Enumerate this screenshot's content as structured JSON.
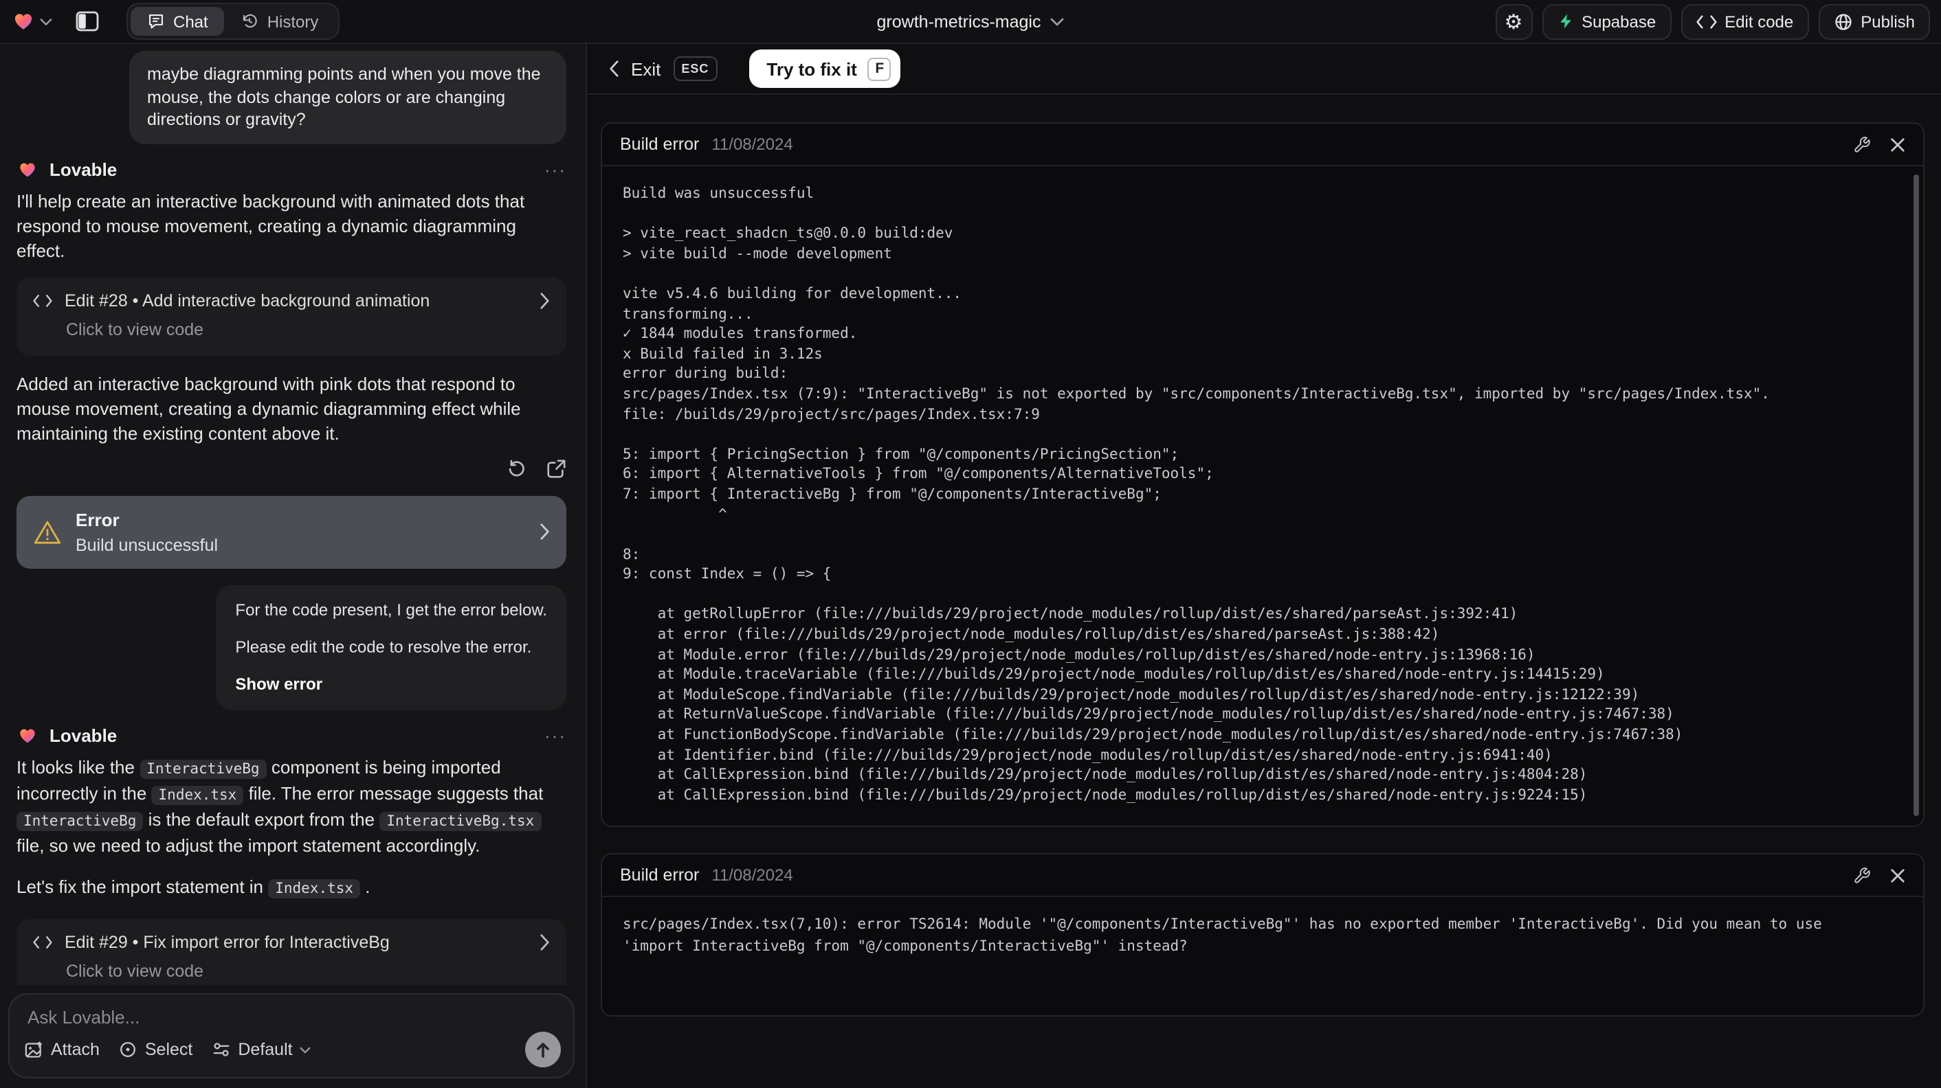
{
  "topbar": {
    "tabs": {
      "chat": "Chat",
      "history": "History"
    },
    "project_name": "growth-metrics-magic",
    "actions": {
      "supabase": "Supabase",
      "edit_code": "Edit code",
      "publish": "Publish"
    }
  },
  "chat": {
    "assistant_name": "Lovable",
    "more_label": "···",
    "user_message": "maybe diagramming points and when you move the mouse, the dots change colors or are changing directions or gravity?",
    "message1": {
      "intro": "I'll help create an interactive background with animated dots that respond to mouse movement, creating a dynamic diagramming effect.",
      "edit_card": {
        "title": "Edit #28 • Add interactive background animation",
        "subtitle": "Click to view code"
      },
      "summary": "Added an interactive background with pink dots that respond to mouse movement, creating a dynamic diagramming effect while maintaining the existing content above it.",
      "error_card": {
        "title": "Error",
        "subtitle": "Build unsuccessful"
      }
    },
    "fix_request": {
      "line1": "For the code present, I get the error below.",
      "line2": "Please edit the code to resolve the error.",
      "action": "Show error"
    },
    "message2": {
      "body_segments": [
        {
          "text": "It looks like the "
        },
        {
          "text": "InteractiveBg",
          "code": true
        },
        {
          "text": " component is being imported incorrectly in the "
        },
        {
          "text": "Index.tsx",
          "code": true
        },
        {
          "text": " file. The error message suggests that "
        },
        {
          "text": "InteractiveBg",
          "code": true
        },
        {
          "text": " is the default export from the "
        },
        {
          "text": "InteractiveBg.tsx",
          "code": true
        },
        {
          "text": " file, so we need to adjust the import statement accordingly."
        }
      ],
      "line2_segments": [
        {
          "text": "Let's fix the import statement in "
        },
        {
          "text": "Index.tsx",
          "code": true
        },
        {
          "text": " ."
        }
      ],
      "edit_card": {
        "title": "Edit #29 • Fix import error for InteractiveBg",
        "subtitle": "Click to view code"
      }
    },
    "composer": {
      "placeholder": "Ask Lovable...",
      "attach": "Attach",
      "select": "Select",
      "mode": "Default"
    }
  },
  "preview": {
    "exit": "Exit",
    "esc": "ESC",
    "fix_button": "Try to fix it",
    "fix_key": "F",
    "cards": [
      {
        "title": "Build error",
        "date": "11/08/2024",
        "log": "Build was unsuccessful\n\n> vite_react_shadcn_ts@0.0.0 build:dev\n> vite build --mode development\n\nvite v5.4.6 building for development...\ntransforming...\n✓ 1844 modules transformed.\nx Build failed in 3.12s\nerror during build:\nsrc/pages/Index.tsx (7:9): \"InteractiveBg\" is not exported by \"src/components/InteractiveBg.tsx\", imported by \"src/pages/Index.tsx\".\nfile: /builds/29/project/src/pages/Index.tsx:7:9\n\n5: import { PricingSection } from \"@/components/PricingSection\";\n6: import { AlternativeTools } from \"@/components/AlternativeTools\";\n7: import { InteractiveBg } from \"@/components/InteractiveBg\";\n           ^\n\n8:\n9: const Index = () => {\n\n    at getRollupError (file:///builds/29/project/node_modules/rollup/dist/es/shared/parseAst.js:392:41)\n    at error (file:///builds/29/project/node_modules/rollup/dist/es/shared/parseAst.js:388:42)\n    at Module.error (file:///builds/29/project/node_modules/rollup/dist/es/shared/node-entry.js:13968:16)\n    at Module.traceVariable (file:///builds/29/project/node_modules/rollup/dist/es/shared/node-entry.js:14415:29)\n    at ModuleScope.findVariable (file:///builds/29/project/node_modules/rollup/dist/es/shared/node-entry.js:12122:39)\n    at ReturnValueScope.findVariable (file:///builds/29/project/node_modules/rollup/dist/es/shared/node-entry.js:7467:38)\n    at FunctionBodyScope.findVariable (file:///builds/29/project/node_modules/rollup/dist/es/shared/node-entry.js:7467:38)\n    at Identifier.bind (file:///builds/29/project/node_modules/rollup/dist/es/shared/node-entry.js:6941:40)\n    at CallExpression.bind (file:///builds/29/project/node_modules/rollup/dist/es/shared/node-entry.js:4804:28)\n    at CallExpression.bind (file:///builds/29/project/node_modules/rollup/dist/es/shared/node-entry.js:9224:15)"
      },
      {
        "title": "Build error",
        "date": "11/08/2024",
        "log": "src/pages/Index.tsx(7,10): error TS2614: Module '\"@/components/InteractiveBg\"' has no exported member 'InteractiveBg'. Did you mean to use 'import InteractiveBg from \"@/components/InteractiveBg\"' instead?"
      }
    ]
  },
  "colors": {
    "accent_supabase": "#3ecf8e",
    "warning": "#deb145",
    "fix_pill_bg": "#ffffff",
    "error_card_bg": "#4b4e55"
  }
}
